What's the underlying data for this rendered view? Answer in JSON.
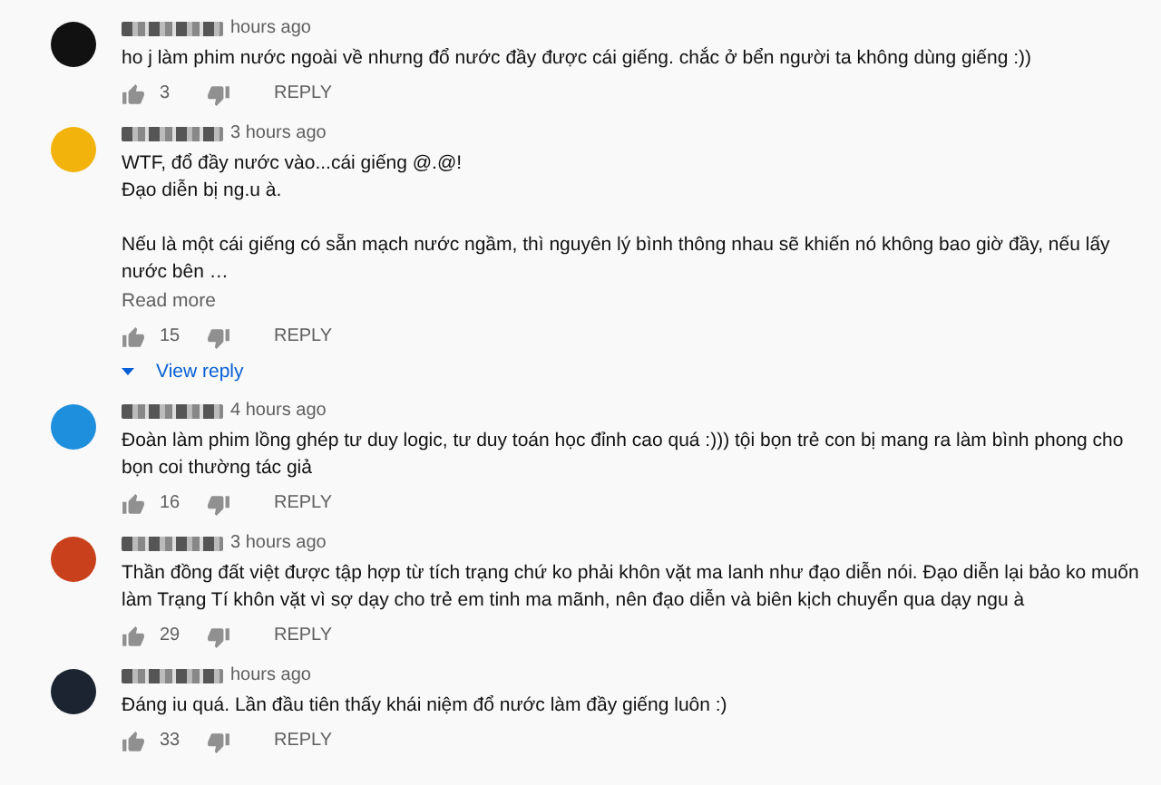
{
  "comments": [
    {
      "color": "#111111",
      "time": "hours ago",
      "text": "ho j làm phim nước ngoài về nhưng đổ nước đầy được cái giếng. chắc ở bển người ta không dùng giếng :))",
      "likes": "3",
      "reply": "REPLY"
    },
    {
      "color": "#f2b40c",
      "time": "3 hours ago",
      "text": "WTF, đổ đầy nước vào...cái giếng @.@!\nĐạo diễn bị ng.u à.\n\nNếu là một cái giếng có sẵn mạch nước ngầm, thì nguyên lý bình thông nhau sẽ khiến nó không bao giờ đầy, nếu lấy nước bên …",
      "read_more": "Read more",
      "likes": "15",
      "reply": "REPLY",
      "view_replies": "View reply"
    },
    {
      "color": "#1e8fdc",
      "time": "4 hours ago",
      "text": "Đoàn làm phim lồng ghép tư duy logic, tư duy toán học đỉnh cao quá :))) tội bọn trẻ con bị mang ra làm bình phong cho bọn coi thường tác giả",
      "likes": "16",
      "reply": "REPLY"
    },
    {
      "color": "#c9401c",
      "time": "3 hours ago",
      "text": "Thần đồng đất việt được tập hợp từ tích trạng chứ ko phải khôn vặt ma lanh như đạo diễn nói. Đạo diễn lại bảo ko muốn làm Trạng Tí khôn vặt vì sợ dạy cho trẻ em tinh ma mãnh, nên đạo diễn và biên kịch chuyển qua dạy ngu à",
      "likes": "29",
      "reply": "REPLY"
    },
    {
      "color": "#1b2430",
      "time": "hours ago",
      "text": "Đáng iu quá. Lần đầu tiên thấy khái niệm đổ nước làm đầy giếng luôn :)",
      "likes": "33",
      "reply": "REPLY"
    }
  ]
}
